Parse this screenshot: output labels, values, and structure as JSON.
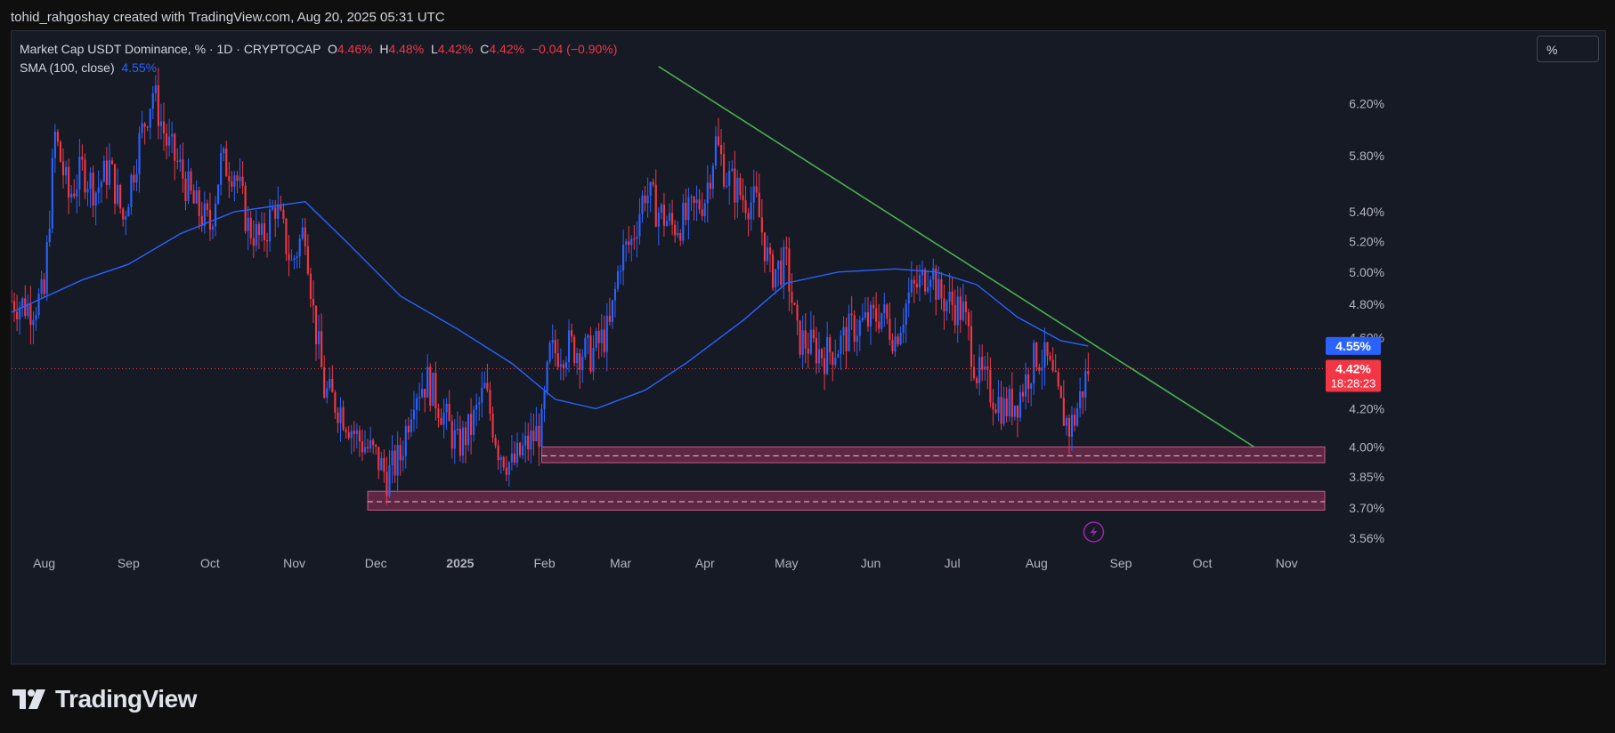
{
  "header": {
    "attribution": "tohid_rahgoshay created with TradingView.com, Aug 20, 2025 05:31 UTC"
  },
  "legend": {
    "symbol": "Market Cap USDT Dominance, % · 1D · CRYPTOCAP",
    "open_label": "O",
    "open": "4.46%",
    "high_label": "H",
    "high": "4.48%",
    "low_label": "L",
    "low": "4.42%",
    "close_label": "C",
    "close": "4.42%",
    "change": "−0.04 (−0.90%)",
    "sma_label": "SMA (100, close)",
    "sma_value": "4.55%"
  },
  "scale_button": "%",
  "footer": {
    "brand": "TradingView"
  },
  "colors": {
    "up": "#2962ff",
    "down": "#f23645",
    "sma": "#2962ff",
    "trendline": "#4caf50",
    "zone_fill": "#7a2c4f",
    "background": "#161a25"
  },
  "chart_data": {
    "type": "candlestick",
    "title": "Market Cap USDT Dominance, % · 1D · CRYPTOCAP",
    "y_scale": "log",
    "y_ticks": [
      "6.20%",
      "5.80%",
      "5.40%",
      "5.20%",
      "5.00%",
      "4.80%",
      "4.60%",
      "4.20%",
      "4.00%",
      "3.85%",
      "3.70%",
      "3.56%"
    ],
    "y_tick_values": [
      6.2,
      5.8,
      5.4,
      5.2,
      5.0,
      4.8,
      4.6,
      4.2,
      4.0,
      3.85,
      3.7,
      3.56
    ],
    "x_ticks": [
      "Aug",
      "Sep",
      "Oct",
      "Nov",
      "Dec",
      "2025",
      "Feb",
      "Mar",
      "Apr",
      "May",
      "Jun",
      "Jul",
      "Aug",
      "Sep",
      "Oct",
      "Nov"
    ],
    "x_tick_dates": [
      "2024-08-01",
      "2024-09-01",
      "2024-10-01",
      "2024-11-01",
      "2024-12-01",
      "2025-01-01",
      "2025-02-01",
      "2025-03-01",
      "2025-04-01",
      "2025-05-01",
      "2025-06-01",
      "2025-07-01",
      "2025-08-01",
      "2025-09-01",
      "2025-10-01",
      "2025-11-01"
    ],
    "x_range": [
      "2024-07-20",
      "2025-11-15"
    ],
    "ylim": [
      3.5,
      6.8
    ],
    "close_path": [
      [
        "2024-07-20",
        4.82
      ],
      [
        "2024-07-27",
        4.78
      ],
      [
        "2024-08-01",
        4.85
      ],
      [
        "2024-08-05",
        5.95
      ],
      [
        "2024-08-10",
        5.5
      ],
      [
        "2024-08-15",
        5.7
      ],
      [
        "2024-08-20",
        5.55
      ],
      [
        "2024-08-25",
        5.72
      ],
      [
        "2024-08-30",
        5.35
      ],
      [
        "2024-09-05",
        5.9
      ],
      [
        "2024-09-10",
        6.3
      ],
      [
        "2024-09-15",
        5.9
      ],
      [
        "2024-09-20",
        5.7
      ],
      [
        "2024-09-25",
        5.45
      ],
      [
        "2024-10-01",
        5.3
      ],
      [
        "2024-10-05",
        5.75
      ],
      [
        "2024-10-10",
        5.7
      ],
      [
        "2024-10-15",
        5.3
      ],
      [
        "2024-10-20",
        5.2
      ],
      [
        "2024-10-25",
        5.45
      ],
      [
        "2024-10-31",
        5.05
      ],
      [
        "2024-11-05",
        5.3
      ],
      [
        "2024-11-08",
        4.75
      ],
      [
        "2024-11-12",
        4.3
      ],
      [
        "2024-11-18",
        4.2
      ],
      [
        "2024-11-24",
        4.05
      ],
      [
        "2024-12-01",
        3.95
      ],
      [
        "2024-12-05",
        3.85
      ],
      [
        "2024-12-10",
        3.95
      ],
      [
        "2024-12-15",
        4.3
      ],
      [
        "2024-12-20",
        4.35
      ],
      [
        "2024-12-25",
        4.2
      ],
      [
        "2024-12-31",
        4.0
      ],
      [
        "2025-01-05",
        4.1
      ],
      [
        "2025-01-10",
        4.3
      ],
      [
        "2025-01-15",
        4.0
      ],
      [
        "2025-01-20",
        3.9
      ],
      [
        "2025-01-25",
        4.0
      ],
      [
        "2025-01-31",
        4.1
      ],
      [
        "2025-02-03",
        4.5
      ],
      [
        "2025-02-10",
        4.55
      ],
      [
        "2025-02-18",
        4.5
      ],
      [
        "2025-02-25",
        4.65
      ],
      [
        "2025-03-01",
        5.1
      ],
      [
        "2025-03-05",
        5.2
      ],
      [
        "2025-03-10",
        5.55
      ],
      [
        "2025-03-15",
        5.4
      ],
      [
        "2025-03-20",
        5.3
      ],
      [
        "2025-03-25",
        5.35
      ],
      [
        "2025-04-01",
        5.5
      ],
      [
        "2025-04-05",
        5.9
      ],
      [
        "2025-04-09",
        5.65
      ],
      [
        "2025-04-15",
        5.5
      ],
      [
        "2025-04-20",
        5.45
      ],
      [
        "2025-04-25",
        5.0
      ],
      [
        "2025-05-01",
        5.05
      ],
      [
        "2025-05-05",
        4.6
      ],
      [
        "2025-05-10",
        4.55
      ],
      [
        "2025-05-15",
        4.5
      ],
      [
        "2025-05-20",
        4.55
      ],
      [
        "2025-05-25",
        4.65
      ],
      [
        "2025-06-01",
        4.7
      ],
      [
        "2025-06-05",
        4.75
      ],
      [
        "2025-06-10",
        4.6
      ],
      [
        "2025-06-15",
        4.85
      ],
      [
        "2025-06-20",
        4.95
      ],
      [
        "2025-06-23",
        5.05
      ],
      [
        "2025-06-26",
        4.85
      ],
      [
        "2025-07-01",
        4.8
      ],
      [
        "2025-07-05",
        4.75
      ],
      [
        "2025-07-10",
        4.4
      ],
      [
        "2025-07-15",
        4.3
      ],
      [
        "2025-07-20",
        4.2
      ],
      [
        "2025-07-25",
        4.25
      ],
      [
        "2025-08-01",
        4.5
      ],
      [
        "2025-08-05",
        4.45
      ],
      [
        "2025-08-10",
        4.2
      ],
      [
        "2025-08-13",
        4.1
      ],
      [
        "2025-08-15",
        4.15
      ],
      [
        "2025-08-20",
        4.42
      ]
    ],
    "sma_100": [
      [
        "2024-07-20",
        4.75
      ],
      [
        "2024-08-15",
        4.95
      ],
      [
        "2024-09-01",
        5.05
      ],
      [
        "2024-09-20",
        5.25
      ],
      [
        "2024-10-10",
        5.4
      ],
      [
        "2024-10-25",
        5.44
      ],
      [
        "2024-11-05",
        5.47
      ],
      [
        "2024-11-20",
        5.2
      ],
      [
        "2024-12-10",
        4.85
      ],
      [
        "2024-12-31",
        4.65
      ],
      [
        "2025-01-20",
        4.45
      ],
      [
        "2025-02-05",
        4.25
      ],
      [
        "2025-02-20",
        4.2
      ],
      [
        "2025-03-10",
        4.3
      ],
      [
        "2025-03-25",
        4.45
      ],
      [
        "2025-04-15",
        4.7
      ],
      [
        "2025-05-01",
        4.93
      ],
      [
        "2025-05-20",
        5.0
      ],
      [
        "2025-06-10",
        5.02
      ],
      [
        "2025-06-25",
        5.0
      ],
      [
        "2025-07-10",
        4.92
      ],
      [
        "2025-07-25",
        4.72
      ],
      [
        "2025-08-10",
        4.58
      ],
      [
        "2025-08-20",
        4.55
      ]
    ],
    "trendline": [
      [
        "2025-03-15",
        6.5
      ],
      [
        "2025-10-20",
        4.0
      ]
    ],
    "zones": [
      {
        "from": "2025-01-31",
        "to": "2025-11-15",
        "top": 4.0,
        "bottom": 3.92,
        "mid": 3.955
      },
      {
        "from": "2024-11-28",
        "to": "2025-11-15",
        "top": 3.78,
        "bottom": 3.69,
        "mid": 3.73
      }
    ],
    "last_price": 4.42,
    "last_price_label": "4.42%",
    "countdown": "18:28:23",
    "sma_last": 4.55,
    "sma_last_label": "4.55%"
  }
}
